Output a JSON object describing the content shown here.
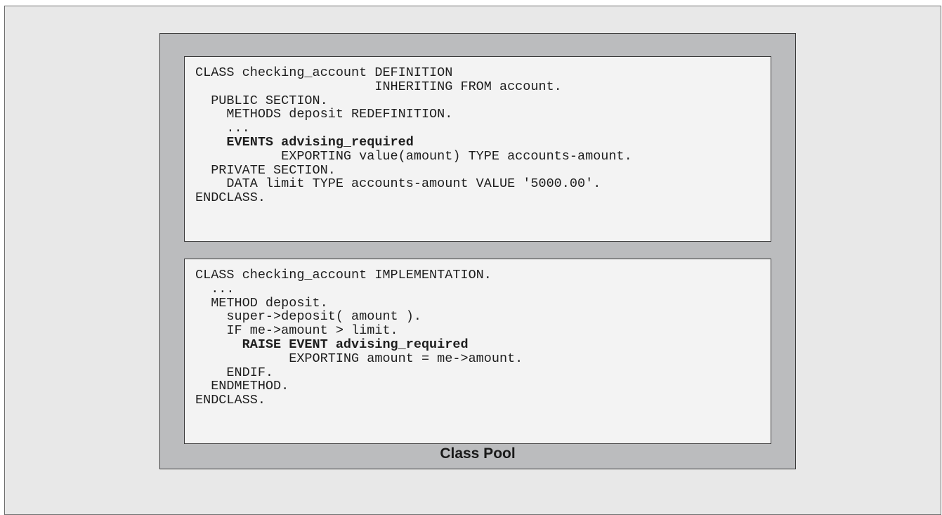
{
  "definition": {
    "lines": [
      {
        "text": "CLASS checking_account DEFINITION",
        "bold": false
      },
      {
        "text": "                       INHERITING FROM account.",
        "bold": false
      },
      {
        "text": "  PUBLIC SECTION.",
        "bold": false
      },
      {
        "text": "    METHODS deposit REDEFINITION.",
        "bold": false
      },
      {
        "text": "    ...",
        "bold": false
      },
      {
        "text": "    EVENTS advising_required",
        "bold": true
      },
      {
        "text": "           EXPORTING value(amount) TYPE accounts-amount.",
        "bold": false
      },
      {
        "text": "  PRIVATE SECTION.",
        "bold": false
      },
      {
        "text": "    DATA limit TYPE accounts-amount VALUE '5000.00'.",
        "bold": false
      },
      {
        "text": "ENDCLASS.",
        "bold": false
      }
    ]
  },
  "implementation": {
    "lines": [
      {
        "text": "CLASS checking_account IMPLEMENTATION.",
        "bold": false
      },
      {
        "text": "  ...",
        "bold": false
      },
      {
        "text": "  METHOD deposit.",
        "bold": false
      },
      {
        "text": "    super->deposit( amount ).",
        "bold": false
      },
      {
        "text": "    IF me->amount > limit.",
        "bold": false
      },
      {
        "text": "      RAISE EVENT advising_required",
        "bold": true
      },
      {
        "text": "            EXPORTING amount = me->amount.",
        "bold": false
      },
      {
        "text": "    ENDIF.",
        "bold": false
      },
      {
        "text": "  ENDMETHOD.",
        "bold": false
      },
      {
        "text": "ENDCLASS.",
        "bold": false
      }
    ]
  },
  "pool_label": "Class Pool"
}
